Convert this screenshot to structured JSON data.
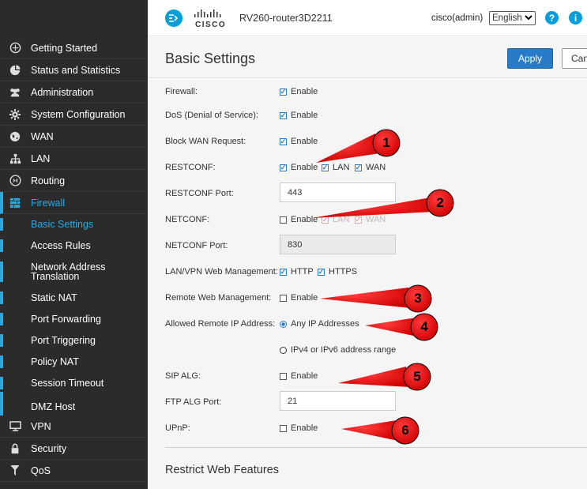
{
  "sidebar": {
    "items": [
      {
        "label": "Getting Started",
        "icon": "getting-started-icon"
      },
      {
        "label": "Status and Statistics",
        "icon": "pie-chart-icon"
      },
      {
        "label": "Administration",
        "icon": "users-icon"
      },
      {
        "label": "System Configuration",
        "icon": "gear-icon"
      },
      {
        "label": "WAN",
        "icon": "globe-icon"
      },
      {
        "label": "LAN",
        "icon": "network-icon"
      },
      {
        "label": "Routing",
        "icon": "routing-icon"
      },
      {
        "label": "Firewall",
        "icon": "firewall-icon"
      }
    ],
    "firewall_subitems": [
      "Basic Settings",
      "Access Rules",
      "Network Address Translation",
      "Static NAT",
      "Port Forwarding",
      "Port Triggering",
      "Policy NAT",
      "Session Timeout",
      "DMZ Host"
    ],
    "bottom_items": [
      {
        "label": "VPN",
        "icon": "vpn-icon"
      },
      {
        "label": "Security",
        "icon": "lock-icon"
      },
      {
        "label": "QoS",
        "icon": "filter-icon"
      }
    ]
  },
  "header": {
    "brand": "CISCO",
    "device_name": "RV260-router3D2211",
    "user": "cisco(admin)",
    "language": "English"
  },
  "titlebar": {
    "title": "Basic Settings",
    "apply": "Apply",
    "cancel": "Canc"
  },
  "form": {
    "firewall": {
      "label": "Firewall:",
      "opt": "Enable",
      "checked": true
    },
    "dos": {
      "label": "DoS (Denial of Service):",
      "opt": "Enable",
      "checked": true
    },
    "block_wan": {
      "label": "Block WAN Request:",
      "opt": "Enable",
      "checked": true
    },
    "restconf": {
      "label": "RESTCONF:",
      "opt": "Enable",
      "lan": "LAN",
      "wan": "WAN"
    },
    "restconf_port": {
      "label": "RESTCONF Port:",
      "value": "443"
    },
    "netconf": {
      "label": "NETCONF:",
      "opt": "Enable",
      "lan": "LAN",
      "wan": "WAN"
    },
    "netconf_port": {
      "label": "NETCONF Port:",
      "value": "830"
    },
    "lan_vpn_mgmt": {
      "label": "LAN/VPN Web Management:",
      "http": "HTTP",
      "https": "HTTPS"
    },
    "remote_mgmt": {
      "label": "Remote Web Management:",
      "opt": "Enable"
    },
    "allowed_ip": {
      "label": "Allowed Remote IP Address:",
      "any": "Any IP Addresses",
      "range": "IPv4 or IPv6 address range"
    },
    "sip_alg": {
      "label": "SIP ALG:",
      "opt": "Enable"
    },
    "ftp_alg_port": {
      "label": "FTP ALG Port:",
      "value": "21"
    },
    "upnp": {
      "label": "UPnP:",
      "opt": "Enable"
    },
    "restrict_title": "Restrict Web Features"
  },
  "annotations": {
    "markers": [
      "1",
      "2",
      "3",
      "4",
      "5",
      "6"
    ],
    "color": "#e8000b"
  },
  "colors": {
    "accent": "#29a9e0",
    "sidebar_bg": "#2b2b2b",
    "apply_bg": "#2a7bc7"
  }
}
